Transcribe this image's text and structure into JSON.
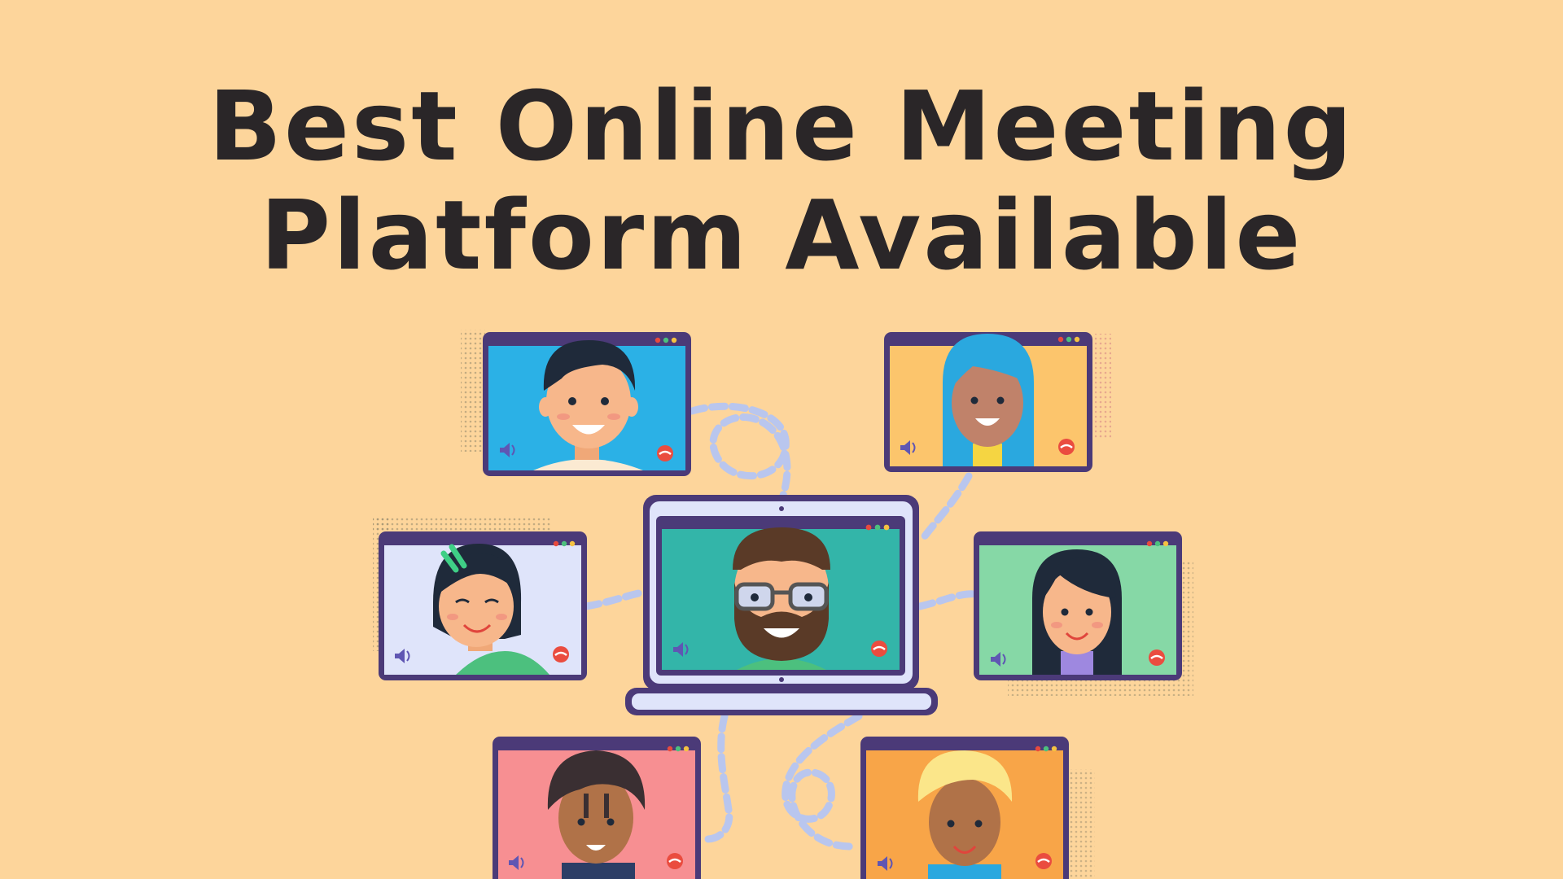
{
  "headline": {
    "line1": "Best Online Meeting",
    "line2": "Platform Available"
  },
  "colors": {
    "background": "#fdd59b",
    "headline": "#2a2628",
    "frame": "#4b3a78",
    "cable": "#b9c6ee",
    "speaker_icon": "#5f56b3",
    "hangup_icon": "#ea4c3f"
  },
  "participants": [
    {
      "id": "top-left",
      "screen_color": "#2bb1e6",
      "icons": [
        "speaker-icon",
        "hang-up-icon"
      ]
    },
    {
      "id": "top-right",
      "screen_color": "#fcc56c",
      "icons": [
        "speaker-icon",
        "hang-up-icon"
      ]
    },
    {
      "id": "mid-left",
      "screen_color": "#dfe4fa",
      "icons": [
        "speaker-icon",
        "hang-up-icon"
      ]
    },
    {
      "id": "center-laptop",
      "screen_color": "#33b5a9",
      "icons": [
        "speaker-icon",
        "hang-up-icon"
      ]
    },
    {
      "id": "mid-right",
      "screen_color": "#86d8a6",
      "icons": [
        "speaker-icon",
        "hang-up-icon"
      ]
    },
    {
      "id": "bottom-left",
      "screen_color": "#f78f92",
      "icons": [
        "speaker-icon",
        "hang-up-icon"
      ]
    },
    {
      "id": "bottom-right",
      "screen_color": "#f8a548",
      "icons": [
        "speaker-icon",
        "hang-up-icon"
      ]
    }
  ]
}
